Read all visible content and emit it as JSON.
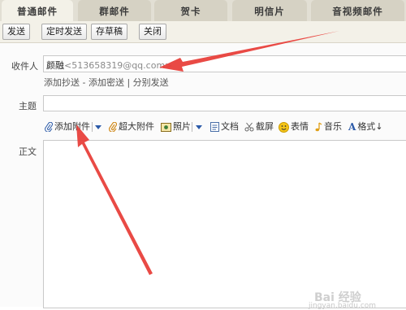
{
  "tabs": [
    {
      "label": "普通邮件",
      "active": true
    },
    {
      "label": "群邮件",
      "active": false
    },
    {
      "label": "贺卡",
      "active": false
    },
    {
      "label": "明信片",
      "active": false
    },
    {
      "label": "音视频邮件",
      "active": false
    }
  ],
  "toolbar": {
    "send": "发送",
    "scheduled_send": "定时发送",
    "save_draft": "存草稿",
    "close": "关闭"
  },
  "recipient": {
    "label": "收件人",
    "name": "颜融",
    "email": "<513658319@qq.com>"
  },
  "recipient_links": {
    "add_cc": "添加抄送",
    "dash": " - ",
    "add_bcc": "添加密送",
    "bar": " | ",
    "separate_send": "分别发送"
  },
  "subject": {
    "label": "主题",
    "value": ""
  },
  "attach_toolbar": {
    "add_attachment": "添加附件",
    "large_attachment": "超大附件",
    "photos": "照片",
    "document": "文档",
    "screenshot": "截屏",
    "emoticon": "表情",
    "music": "音乐",
    "format": "格式"
  },
  "body": {
    "label": "正文",
    "value": ""
  },
  "watermark": {
    "text": "jingyan.baidu.com",
    "logo": "Bai 经验"
  },
  "colors": {
    "arrow": "#e8403b",
    "accent": "#2b5aa8"
  }
}
